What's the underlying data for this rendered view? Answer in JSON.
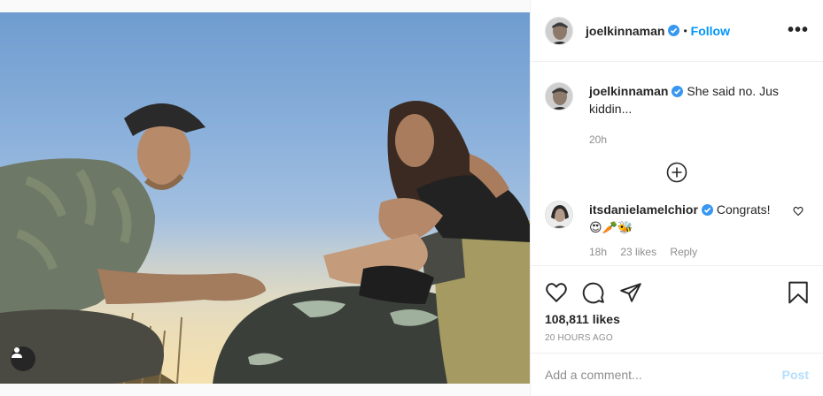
{
  "header": {
    "username": "joelkinnaman",
    "separator": "•",
    "follow_label": "Follow",
    "more_label": "•••"
  },
  "caption": {
    "username": "joelkinnaman",
    "text": "She said no. Jus kiddin...",
    "time": "20h"
  },
  "comment": {
    "username": "itsdanielamelchior",
    "text": "Congrats!",
    "emojis": "😍🥕🐝",
    "meta_time": "18h",
    "meta_likes": "23 likes",
    "meta_reply": "Reply"
  },
  "post": {
    "likes": "108,811 likes",
    "ago": "20 HOURS AGO"
  },
  "add_comment": {
    "placeholder": "Add a comment...",
    "post_label": "Post"
  },
  "colors": {
    "accent": "#0095f6",
    "verified": "#3897f0",
    "post_disabled": "#b2dffc"
  }
}
